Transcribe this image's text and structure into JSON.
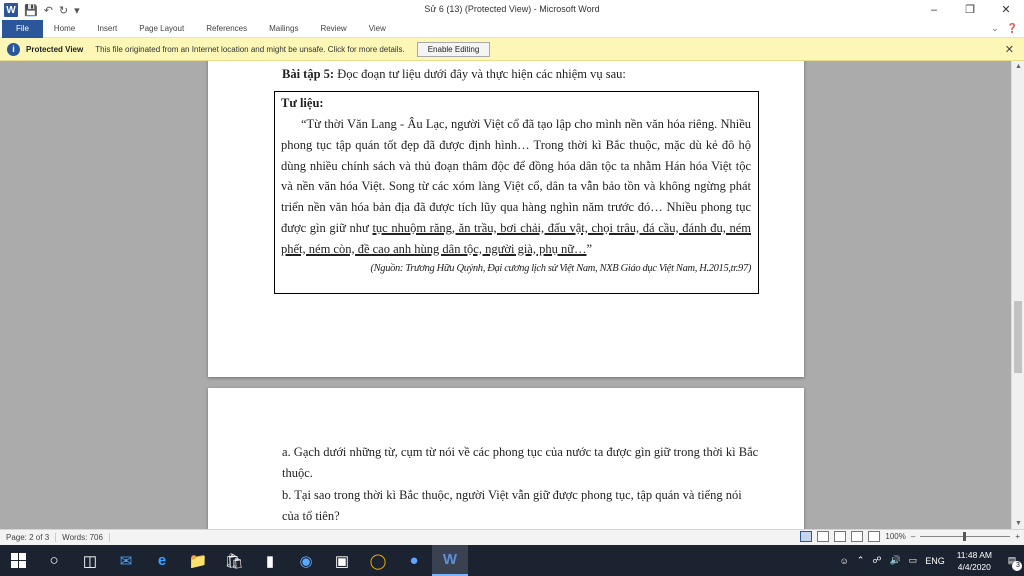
{
  "window": {
    "title": "Sử 6 (13) (Protected View) - Microsoft Word",
    "app_logo": "W",
    "controls": {
      "minimize": "–",
      "restore": "❐",
      "close": "✕"
    }
  },
  "ribbon": {
    "tabs": [
      "File",
      "Home",
      "Insert",
      "Page Layout",
      "References",
      "Mailings",
      "Review",
      "View"
    ]
  },
  "protected_view": {
    "title": "Protected View",
    "message": "This file originated from an Internet location and might be unsafe. Click for more details.",
    "button": "Enable Editing"
  },
  "document": {
    "exercise_heading": "Bài tập 5:",
    "exercise_text": " Đọc đoạn tư liệu dưới đây và thực hiện các nhiệm vụ sau:",
    "box_title": "Tư liệu:",
    "quote_plain": "“Từ thời Văn Lang - Âu Lạc, người Việt cổ đã tạo lập cho mình nền văn hóa riêng. Nhiều phong tục tập quán tốt đẹp đã được định hình… Trong thời kì Bắc thuộc, mặc dù kẻ đô hộ dùng nhiều chính sách và thủ đoạn thâm độc để đồng hóa dân tộc ta nhằm Hán hóa Việt tộc và nền văn hóa Việt. Song từ các xóm làng Việt cổ, dân ta vẫn bảo tồn và không ngừng phát triển nền văn hóa bản địa đã được tích lũy qua hàng nghìn năm trước đó… Nhiều phong tục được gìn giữ như ",
    "quote_underlined": "tục nhuộm răng, ăn trầu, bơi chải, đấu vật, chọi trâu, đá cầu, đánh đu, ném phết, ném còn, đề cao anh hùng dân tộc, người già, phụ nữ…",
    "quote_end": "”",
    "source": "(Nguồn: Trương Hữu Quýnh, Đại cương lịch sử Việt Nam, NXB Giáo dục Việt Nam, H.2015,tr.97)",
    "question_a": "a. Gạch dưới những từ, cụm từ nói về các phong tục của nước ta được gìn giữ trong thời kì Bắc thuộc.",
    "question_b": "b. Tại sao trong thời kì Bắc thuộc, người Việt vẫn giữ được phong tục, tập quán và tiếng nói của tổ tiên?"
  },
  "status_bar": {
    "page": "Page: 2 of 3",
    "words": "Words: 706",
    "zoom": "100%",
    "zoom_out": "–",
    "zoom_in": "+"
  },
  "taskbar": {
    "language": "ENG",
    "time": "11:48 AM",
    "date": "4/4/2020",
    "notification_count": "3"
  },
  "icons": {
    "save": "save-icon",
    "undo": "undo-icon",
    "redo": "redo-icon",
    "shield": "shield-icon"
  },
  "colors": {
    "word_blue": "#2b579a",
    "protected_bar": "#fcf7b6",
    "taskbar": "#1c2330"
  }
}
